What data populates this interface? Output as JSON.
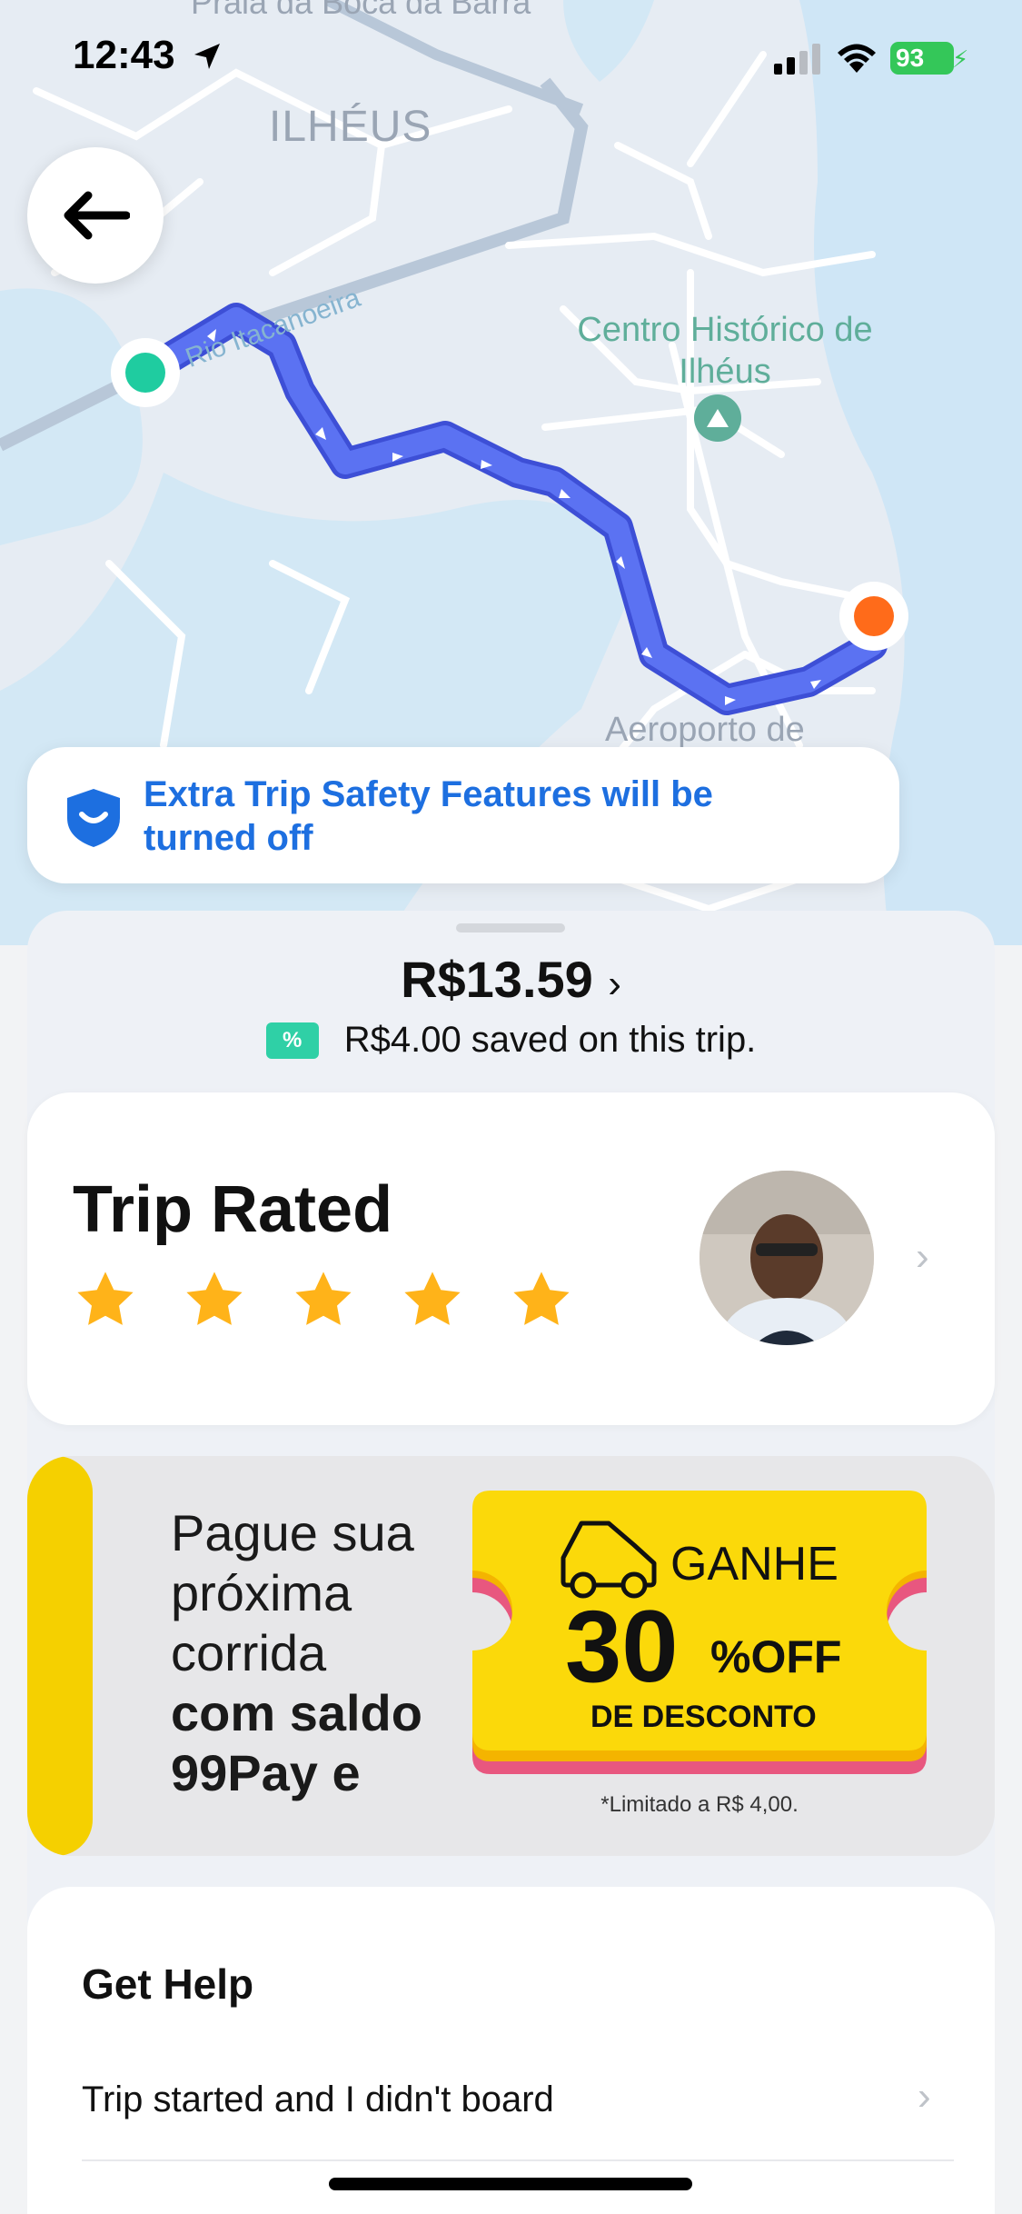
{
  "status_bar": {
    "time": "12:43",
    "battery": "93"
  },
  "map": {
    "labels": {
      "praia": "Praia da Boca da Barra",
      "city": "ILHÉUS",
      "centro": "Centro Histórico de Ilhéus",
      "rio": "Rio Itacanoeira",
      "aeroporto": "Aeroporto de"
    },
    "route_color": "#5b72f2",
    "origin_color": "#1fcca0",
    "destination_color": "#ff6b1a"
  },
  "safety_banner": {
    "text": "Extra Trip Safety Features will be turned off",
    "color": "#1d6fe0"
  },
  "price": {
    "amount": "R$13.59",
    "chevron": "›",
    "savings_badge": "%",
    "savings_text": "R$4.00 saved on this trip."
  },
  "trip_rated": {
    "title": "Trip Rated",
    "rating": 5,
    "max_rating": 5,
    "star_color": "#ffb319"
  },
  "promo": {
    "line1": "Pague sua",
    "line2": "próxima",
    "line3": "corrida",
    "line4": "com saldo",
    "line5": "99Pay e",
    "ganhe": "GANHE",
    "big_number": "30",
    "off": "%OFF",
    "desconto": "DE DESCONTO",
    "limit": "*Limitado a R$ 4,00.",
    "accent": "#f5d000"
  },
  "help": {
    "title": "Get Help",
    "items": [
      {
        "label": "Trip started and I didn't board"
      }
    ]
  }
}
